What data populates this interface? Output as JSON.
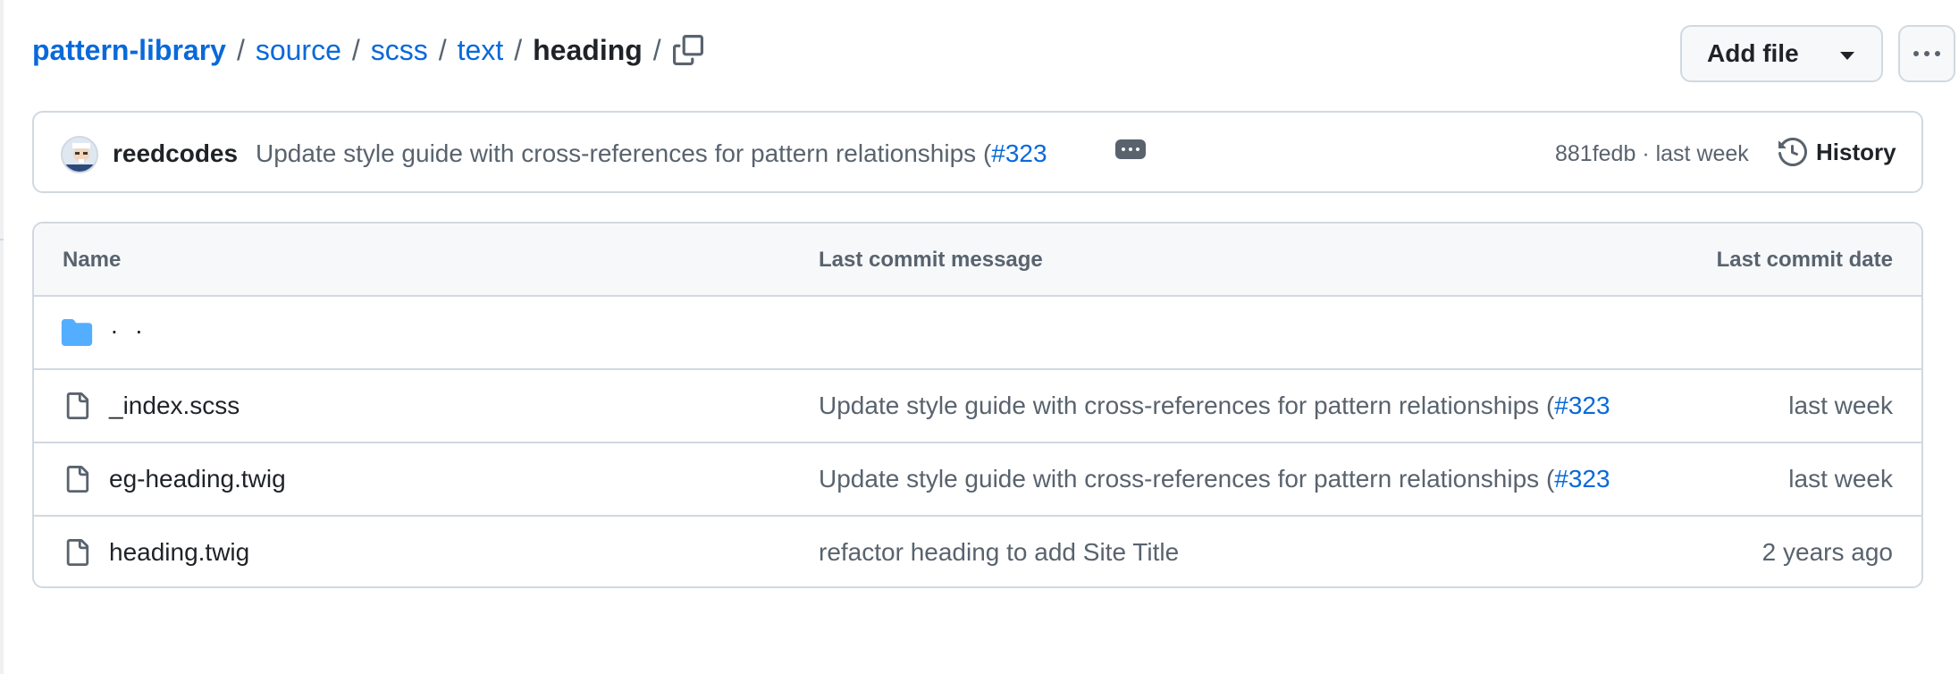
{
  "breadcrumb": {
    "items": [
      "pattern-library",
      "source",
      "scss",
      "text"
    ],
    "current": "heading",
    "separator": "/"
  },
  "actions": {
    "add_file_label": "Add file",
    "copy_icon": "copy-icon",
    "more_icon": "kebab-horizontal-icon"
  },
  "latest_commit": {
    "author": "reedcodes",
    "message": "Update style guide with cross-references for pattern relationships (",
    "pr_ref": "#323",
    "sha": "881fedb",
    "meta_separator": " · ",
    "time": "last week",
    "history_label": "History"
  },
  "table": {
    "headers": {
      "name": "Name",
      "message": "Last commit message",
      "date": "Last commit date"
    },
    "parent_label": ". .",
    "rows": [
      {
        "name": "_index.scss",
        "message": "Update style guide with cross-references for pattern relationships (",
        "pr_ref": "#323",
        "date": "last week"
      },
      {
        "name": "eg-heading.twig",
        "message": "Update style guide with cross-references for pattern relationships (",
        "pr_ref": "#323",
        "date": "last week"
      },
      {
        "name": "heading.twig",
        "message": "refactor heading to add Site Title",
        "pr_ref": "",
        "date": "2 years ago"
      }
    ]
  },
  "colors": {
    "link": "#0969da",
    "muted": "#59636e",
    "border": "#d1d9e0",
    "folder": "#54aeff",
    "header_bg": "#f6f8fa"
  }
}
